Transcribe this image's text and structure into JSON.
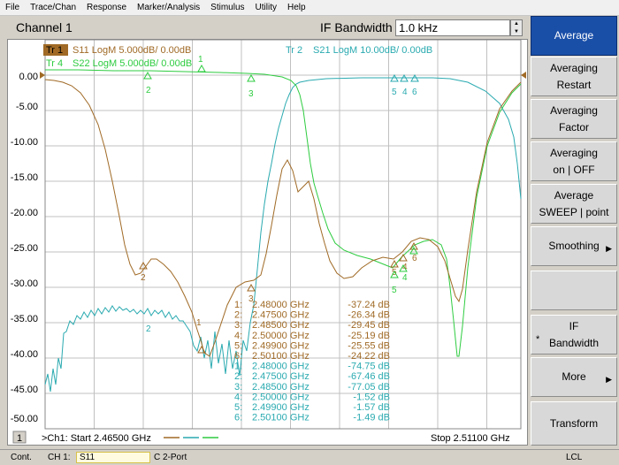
{
  "menu": [
    "File",
    "Trace/Chan",
    "Response",
    "Marker/Analysis",
    "Stimulus",
    "Utility",
    "Help"
  ],
  "channel_title": "Channel 1",
  "ifbw": {
    "label": "IF Bandwidth",
    "value": "1.0 kHz"
  },
  "traces": [
    {
      "id": "tr1",
      "tag": "Tr 1",
      "text": "S11 LogM 5.000dB/  0.00dB",
      "color": "#a06a26"
    },
    {
      "id": "tr4",
      "tag": "Tr 4",
      "text": "S22 LogM 5.000dB/  0.00dB",
      "color": "#2ecc40"
    },
    {
      "id": "tr2",
      "tag": "Tr  2",
      "text": "S21 LogM 10.00dB/  0.00dB",
      "color": "#2aaab0"
    }
  ],
  "y_ticks": [
    "0.00",
    "-5.00",
    "-10.00",
    "-15.00",
    "-20.00",
    "-25.00",
    "-30.00",
    "-35.00",
    "-40.00",
    "-45.00",
    "-50.00"
  ],
  "markers_table": [
    {
      "num": "1:",
      "freq": "2.48000 GHz",
      "val": "-37.24 dB",
      "color": "#a06a26"
    },
    {
      "num": "2:",
      "freq": "2.47500 GHz",
      "val": "-26.34 dB",
      "color": "#a06a26"
    },
    {
      "num": "3:",
      "freq": "2.48500 GHz",
      "val": "-29.45 dB",
      "color": "#a06a26"
    },
    {
      "num": "4:",
      "freq": "2.50000 GHz",
      "val": "-25.19 dB",
      "color": "#a06a26"
    },
    {
      "num": "5:",
      "freq": "2.49900 GHz",
      "val": "-25.55 dB",
      "color": "#a06a26"
    },
    {
      "num": "6:",
      "freq": "2.50100 GHz",
      "val": "-24.22 dB",
      "color": "#a06a26"
    },
    {
      "num": "1:",
      "freq": "2.48000 GHz",
      "val": "-74.75 dB",
      "color": "#2aaab0"
    },
    {
      "num": "2:",
      "freq": "2.47500 GHz",
      "val": "-67.46 dB",
      "color": "#2aaab0"
    },
    {
      "num": "3:",
      "freq": "2.48500 GHz",
      "val": "-77.05 dB",
      "color": "#2aaab0"
    },
    {
      "num": "4:",
      "freq": "2.50000 GHz",
      "val": "-1.52 dB",
      "color": "#2aaab0"
    },
    {
      "num": "5:",
      "freq": "2.49900 GHz",
      "val": "-1.57 dB",
      "color": "#2aaab0"
    },
    {
      "num": "6:",
      "freq": "2.50100 GHz",
      "val": "-1.49 dB",
      "color": "#2aaab0"
    }
  ],
  "footer": {
    "channel_num": "1",
    "start": ">Ch1: Start  2.46500 GHz",
    "stop": "Stop  2.51100 GHz"
  },
  "softkeys": [
    {
      "id": "average",
      "line1": "Average",
      "line2": "",
      "active": true,
      "arrow": false,
      "star": false
    },
    {
      "id": "averaging-restart",
      "line1": "Averaging",
      "line2": "Restart",
      "active": false,
      "arrow": false,
      "star": false
    },
    {
      "id": "averaging-factor",
      "line1": "Averaging",
      "line2": "Factor",
      "active": false,
      "arrow": false,
      "star": false
    },
    {
      "id": "averaging-on-off",
      "line1": "Averaging",
      "line2": "on | OFF",
      "active": false,
      "arrow": false,
      "star": false
    },
    {
      "id": "average-sweep-point",
      "line1": "Average",
      "line2": "SWEEP | point",
      "active": false,
      "arrow": false,
      "star": false
    },
    {
      "id": "smoothing",
      "line1": "Smoothing",
      "line2": "",
      "active": false,
      "arrow": true,
      "star": false
    },
    {
      "id": "blank",
      "line1": "",
      "line2": "",
      "active": false,
      "arrow": false,
      "star": false
    },
    {
      "id": "if-bandwidth",
      "line1": "IF",
      "line2": "Bandwidth",
      "active": false,
      "arrow": false,
      "star": true
    },
    {
      "id": "more",
      "line1": "More",
      "line2": "",
      "active": false,
      "arrow": true,
      "star": false
    },
    {
      "id": "transform",
      "line1": "Transform",
      "line2": "",
      "active": false,
      "arrow": false,
      "star": false
    }
  ],
  "status": {
    "left": "Cont.",
    "channel": "CH 1:",
    "trace": "S11",
    "mode": "C  2-Port",
    "right": "LCL"
  },
  "colors": {
    "s11": "#a06a26",
    "s22": "#2ecc40",
    "s21": "#2aaab0",
    "active_softkey": "#1a4fa8"
  }
}
